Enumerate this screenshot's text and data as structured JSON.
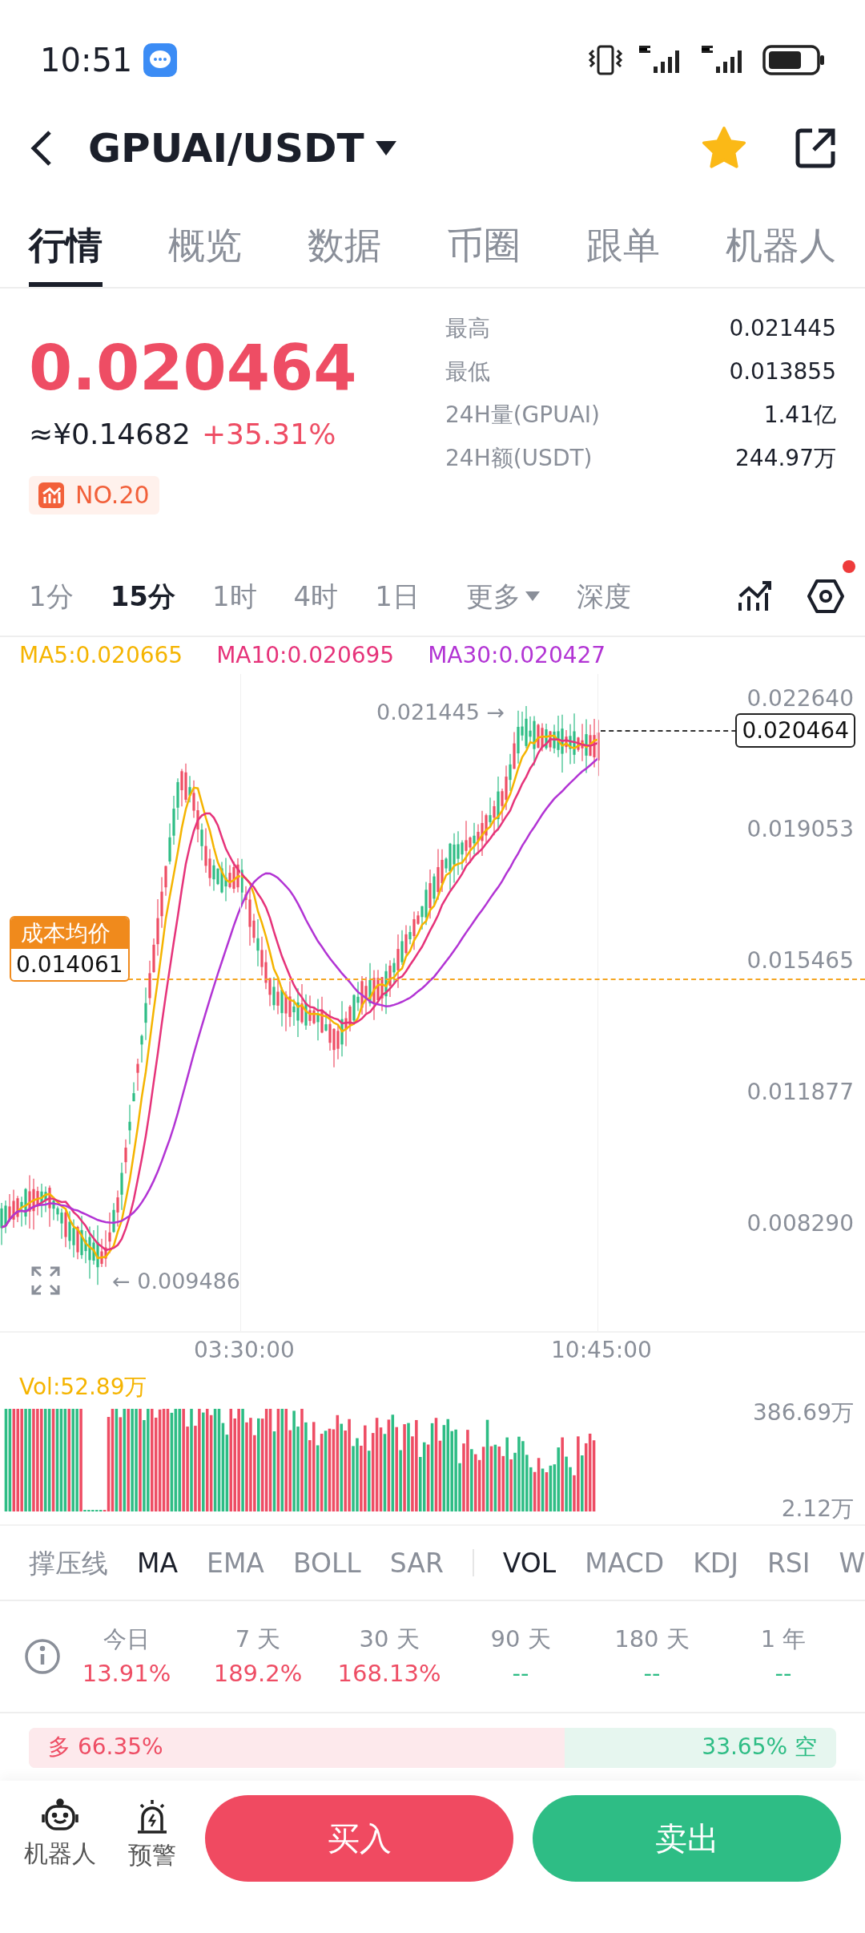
{
  "status_bar": {
    "time": "10:51"
  },
  "header": {
    "pair": "GPUAI/USDT",
    "favorite": true
  },
  "tabs": [
    {
      "label": "行情",
      "selected": true
    },
    {
      "label": "概览",
      "selected": false
    },
    {
      "label": "数据",
      "selected": false
    },
    {
      "label": "币圈",
      "selected": false
    },
    {
      "label": "跟单",
      "selected": false
    },
    {
      "label": "机器人",
      "selected": false
    }
  ],
  "price": {
    "last": "0.020464",
    "cny": "≈¥0.14682",
    "change": "+35.31%",
    "rank": "NO.20"
  },
  "stats": [
    {
      "label": "最高",
      "value": "0.021445"
    },
    {
      "label": "最低",
      "value": "0.013855"
    },
    {
      "label": "24H量(GPUAI)",
      "value": "1.41亿"
    },
    {
      "label": "24H额(USDT)",
      "value": "244.97万"
    }
  ],
  "intervals": [
    {
      "label": "1分",
      "selected": false,
      "kind": "plain"
    },
    {
      "label": "15分",
      "selected": true,
      "kind": "plain"
    },
    {
      "label": "1时",
      "selected": false,
      "kind": "plain"
    },
    {
      "label": "4时",
      "selected": false,
      "kind": "plain"
    },
    {
      "label": "1日",
      "selected": false,
      "kind": "plain"
    },
    {
      "label": "更多",
      "selected": false,
      "kind": "dropdown"
    },
    {
      "label": "深度",
      "selected": false,
      "kind": "plain"
    }
  ],
  "settings_dot": true,
  "chart": {
    "ma": [
      {
        "label": "MA5:0.020665",
        "color": "#f5b400"
      },
      {
        "label": "MA10:0.020695",
        "color": "#e6337a"
      },
      {
        "label": "MA30:0.020427",
        "color": "#b234d4"
      }
    ],
    "price_ticks": [
      "0.022640",
      "0.019053",
      "0.015465",
      "0.011877",
      "0.008290"
    ],
    "high_marker": "0.021445 →",
    "low_marker": "← 0.009486",
    "last_price": "0.020464",
    "cost_label": "成本均价",
    "cost_value": "0.014061",
    "time_ticks": [
      "03:30:00",
      "10:45:00"
    ]
  },
  "volume": {
    "label": "Vol:52.89万",
    "ticks": [
      "386.69万",
      "2.12万"
    ]
  },
  "main_indicators": [
    {
      "label": "撑压线",
      "selected": false
    },
    {
      "label": "MA",
      "selected": true
    },
    {
      "label": "EMA",
      "selected": false
    },
    {
      "label": "BOLL",
      "selected": false
    },
    {
      "label": "SAR",
      "selected": false
    }
  ],
  "sub_indicators": [
    {
      "label": "VOL",
      "selected": true
    },
    {
      "label": "MACD",
      "selected": false
    },
    {
      "label": "KDJ",
      "selected": false
    },
    {
      "label": "RSI",
      "selected": false
    },
    {
      "label": "W",
      "selected": false
    }
  ],
  "returns": [
    {
      "period": "今日",
      "value": "13.91%",
      "color": "#ee4d64"
    },
    {
      "period": "7 天",
      "value": "189.2%",
      "color": "#ee4d64"
    },
    {
      "period": "30 天",
      "value": "168.13%",
      "color": "#ee4d64"
    },
    {
      "period": "90 天",
      "value": "--",
      "color": "#2ebd85"
    },
    {
      "period": "180 天",
      "value": "--",
      "color": "#2ebd85"
    },
    {
      "period": "1 年",
      "value": "--",
      "color": "#2ebd85"
    }
  ],
  "long_short": {
    "long": "多 66.35%",
    "short": "33.65% 空",
    "level": 0.6635
  },
  "bottom_bar": {
    "actions": [
      {
        "label": "机器人",
        "kind": "robot"
      },
      {
        "label": "预警",
        "kind": "alarm"
      }
    ],
    "buy": "买入",
    "sell": "卖出"
  }
}
